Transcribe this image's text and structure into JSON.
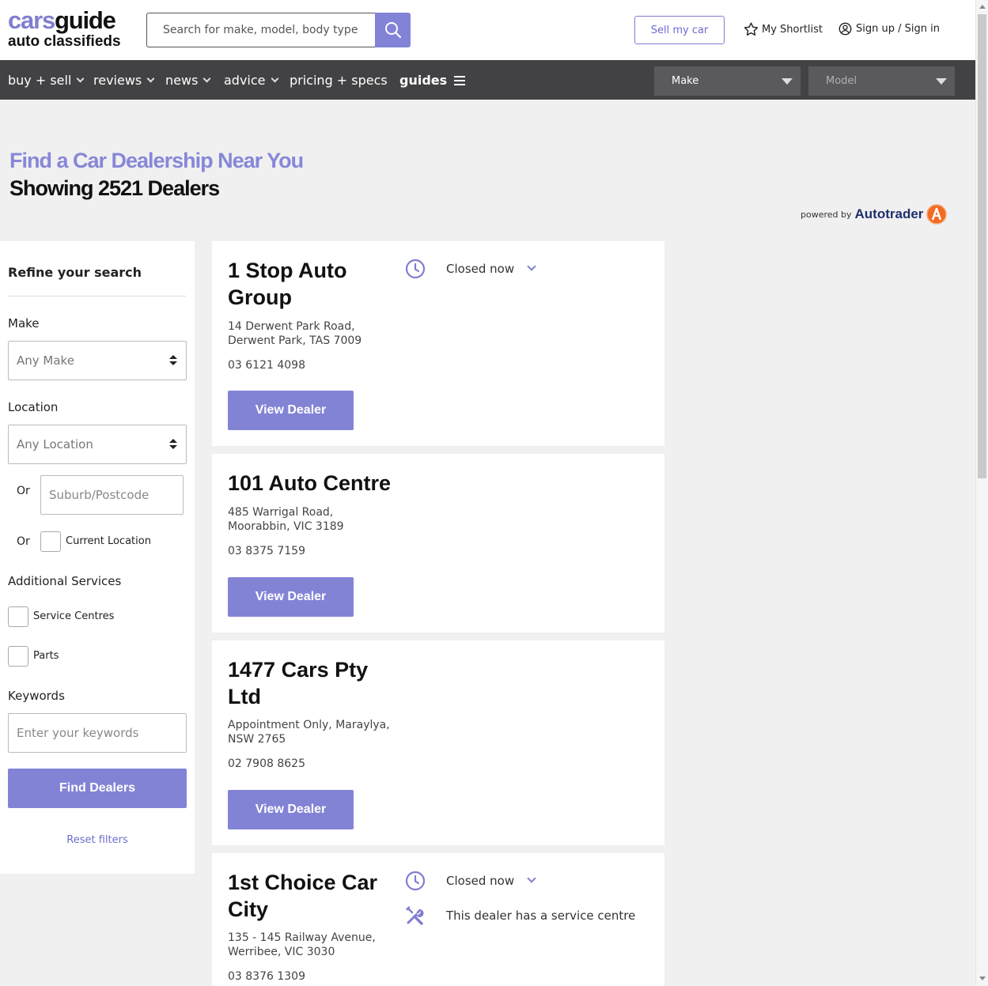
{
  "header": {
    "logo_part1": "cars",
    "logo_part2": "guide",
    "logo_sub": "auto classifieds",
    "search_placeholder": "Search for make, model, body type",
    "search_icon": "search-icon",
    "sell_label": "Sell my car",
    "shortlist_label": "My Shortlist",
    "shortlist_icon": "star-icon",
    "signin_label": "Sign up / Sign in",
    "signin_icon": "user-circle-icon"
  },
  "nav": {
    "items": [
      {
        "label": "buy + sell"
      },
      {
        "label": "reviews"
      },
      {
        "label": "news"
      },
      {
        "label": "advice"
      },
      {
        "label": "pricing + specs"
      },
      {
        "label": "guides"
      }
    ],
    "make_select": "Make",
    "model_select": "Model"
  },
  "intro": {
    "title": "Find a Car Dealership Near You",
    "subtitle": "Showing 2521 Dealers",
    "powered_by": "powered by",
    "powered_brand": "Autotrader"
  },
  "sidebar": {
    "title": "Refine your search",
    "make_label": "Make",
    "make_value": "Any Make",
    "location_label": "Location",
    "location_value": "Any Location",
    "or1": "Or",
    "suburb_placeholder": "Suburb/Postcode",
    "or2": "Or",
    "current_location_label": "Current Location",
    "additional_label": "Additional Services",
    "service_centres_label": "Service Centres",
    "parts_label": "Parts",
    "keywords_label": "Keywords",
    "keywords_placeholder": "Enter your keywords",
    "find_label": "Find Dealers",
    "reset_label": "Reset filters"
  },
  "dealers": [
    {
      "name": "1 Stop Auto Group",
      "address_line1": "14 Derwent Park Road,",
      "address_line2": "Derwent Park, TAS 7009",
      "phone": "03 6121 4098",
      "status": "Closed now",
      "button": "View Dealer"
    },
    {
      "name": "101 Auto Centre",
      "address_line1": "485 Warrigal Road,",
      "address_line2": "Moorabbin, VIC 3189",
      "phone": "03 8375 7159",
      "button": "View Dealer"
    },
    {
      "name": "1477 Cars Pty Ltd",
      "address_line1": "Appointment Only, Maraylya,",
      "address_line2": "NSW 2765",
      "phone": "02 7908 8625",
      "button": "View Dealer"
    },
    {
      "name": "1st Choice Car City",
      "address_line1": "135 - 145 Railway Avenue,",
      "address_line2": "Werribee, VIC 3030",
      "phone": "03 8376 1309",
      "status": "Closed now",
      "service": "This dealer has a service centre"
    }
  ],
  "colors": {
    "brand": "#8383d6",
    "nav_bg": "#424244",
    "page_bg": "#f0f0f0"
  }
}
